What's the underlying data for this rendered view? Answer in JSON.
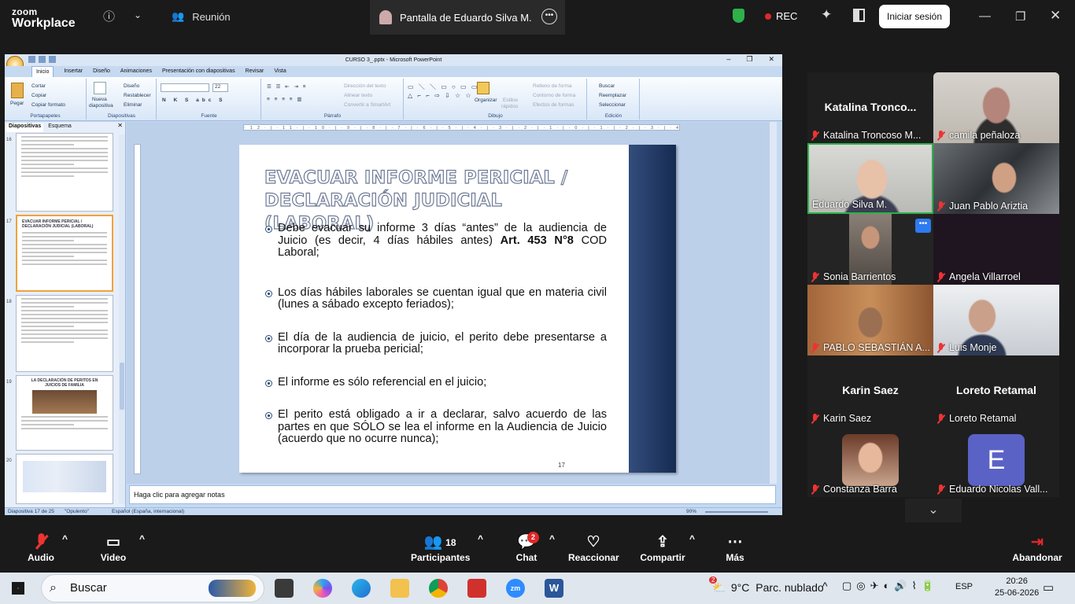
{
  "zoom": {
    "logo_line1": "zoom",
    "logo_line2": "Workplace",
    "meeting_label": "Reunión",
    "screen_share_tab": "Pantalla de Eduardo Silva M.",
    "rec_label": "REC",
    "signin_label": "Iniciar sesión"
  },
  "ppt": {
    "window_title": "CURSO 3_.pptx - Microsoft PowerPoint",
    "ribbon_tabs": [
      "Inicio",
      "Insertar",
      "Diseño",
      "Animaciones",
      "Presentación con diapositivas",
      "Revisar",
      "Vista"
    ],
    "groups": {
      "portapapeles": "Portapapeles",
      "diapositivas": "Diapositivas",
      "fuente": "Fuente",
      "parrafo": "Párrafo",
      "dibujo": "Dibujo",
      "edicion": "Edición"
    },
    "buttons": {
      "pegar": "Pegar",
      "cortar": "Cortar",
      "copiar": "Copiar",
      "copiar_formato": "Copiar formato",
      "nueva_diapositiva_1": "Nueva",
      "nueva_diapositiva_2": "diapositiva",
      "diseno": "Diseño",
      "restablecer": "Restablecer",
      "eliminar": "Eliminar",
      "font_size": "22",
      "direccion_texto": "Dirección del texto",
      "alinear_texto": "Alinear texto",
      "convertir_smartart": "Convertir a SmartArt",
      "organizar": "Organizar",
      "estilos_rapidos_1": "Estilos",
      "estilos_rapidos_2": "rápidos",
      "relleno_forma": "Relleno de forma",
      "contorno_forma": "Contorno de forma",
      "efectos_formas": "Efectos de formas",
      "buscar": "Buscar",
      "reemplazar": "Reemplazar",
      "seleccionar": "Seleccionar"
    },
    "pane_tabs": [
      "Diapositivas",
      "Esquema"
    ],
    "thumb_numbers": [
      "16",
      "17",
      "18",
      "19",
      "20"
    ],
    "thumb17_title": "EVACUAR INFORME PERICIAL / DECLARACIÓN JUDICIAL (LABORAL)",
    "thumb19_title": "LA DECLARACIÓN DE PERITOS EN JUICIOS DE FAMILIA",
    "ruler_text": "·12·|·11·|·10·|·9·|·8·|·7·|·6·|·5·|·4·|·3·|·2·|·1·|·0·|·1·|·2·|·3·|·4·|·5·|·6·|·7·|·8·|·9·|·10·|·11·|·12·",
    "slide": {
      "title_line1": "EVACUAR INFORME PERICIAL /",
      "title_line2": "DECLARACIÓN JUDICIAL (LABORAL)",
      "bullet1_text": "Debe evacuar su informe 3 días “antes” de la audiencia de Juicio (es decir, 4 días hábiles antes) ",
      "bullet1_bold": "Art. 453 N°8",
      "bullet1_tail": " COD Laboral;",
      "bullet2": "Los días hábiles laborales se cuentan igual que en materia civil (lunes a sábado excepto feriados);",
      "bullet3": "El día de la audiencia de juicio, el perito debe presentarse a incorporar la prueba pericial;",
      "bullet4": "El informe es sólo referencial en el juicio;",
      "bullet5": "El perito está obligado a ir a declarar, salvo acuerdo de las partes en que SÓLO se lea el informe en la Audiencia de Juicio (acuerdo que no ocurre nunca);",
      "number": "17"
    },
    "notes_placeholder": "Haga clic para agregar notas",
    "status_slide": "Diapositiva 17 de 25",
    "status_theme": "\"Opulento\"",
    "status_lang": "Español (España, internacional)",
    "status_zoom": "90%"
  },
  "participants": [
    {
      "name": "Katalina Troncoso M...",
      "big": "Katalina  Tronco..."
    },
    {
      "name": "camila peñaloza"
    },
    {
      "name": "Eduardo Silva M."
    },
    {
      "name": "Juan Pablo Ariztia"
    },
    {
      "name": "Sonia Barrientos"
    },
    {
      "name": "Angela Villarroel"
    },
    {
      "name": "PABLO SEBASTIÁN A..."
    },
    {
      "name": "Luis Monje"
    },
    {
      "name": "Karin Saez",
      "big": "Karin Saez"
    },
    {
      "name": "Loreto Retamal",
      "big": "Loreto Retamal"
    },
    {
      "name": "Constanza Barra"
    },
    {
      "name": "Eduardo Nicolas Vall...",
      "initial": "E"
    }
  ],
  "controls": {
    "audio": "Audio",
    "video": "Video",
    "participants": "Participantes",
    "participants_count": "18",
    "chat": "Chat",
    "chat_badge": "2",
    "reactions": "Reaccionar",
    "share": "Compartir",
    "more": "Más",
    "leave": "Abandonar"
  },
  "taskbar": {
    "search": "Buscar",
    "weather_temp": "9°C",
    "weather_desc": "Parc. nublado",
    "weather_badge": "2",
    "lang": "ESP",
    "time": "20:26",
    "date": "25-06-2026"
  },
  "colors": {
    "accent_green": "#2db14a",
    "rec_red": "#e02828",
    "active_speaker_border": "#2db14a",
    "avatar_purple": "#5b62c6"
  }
}
